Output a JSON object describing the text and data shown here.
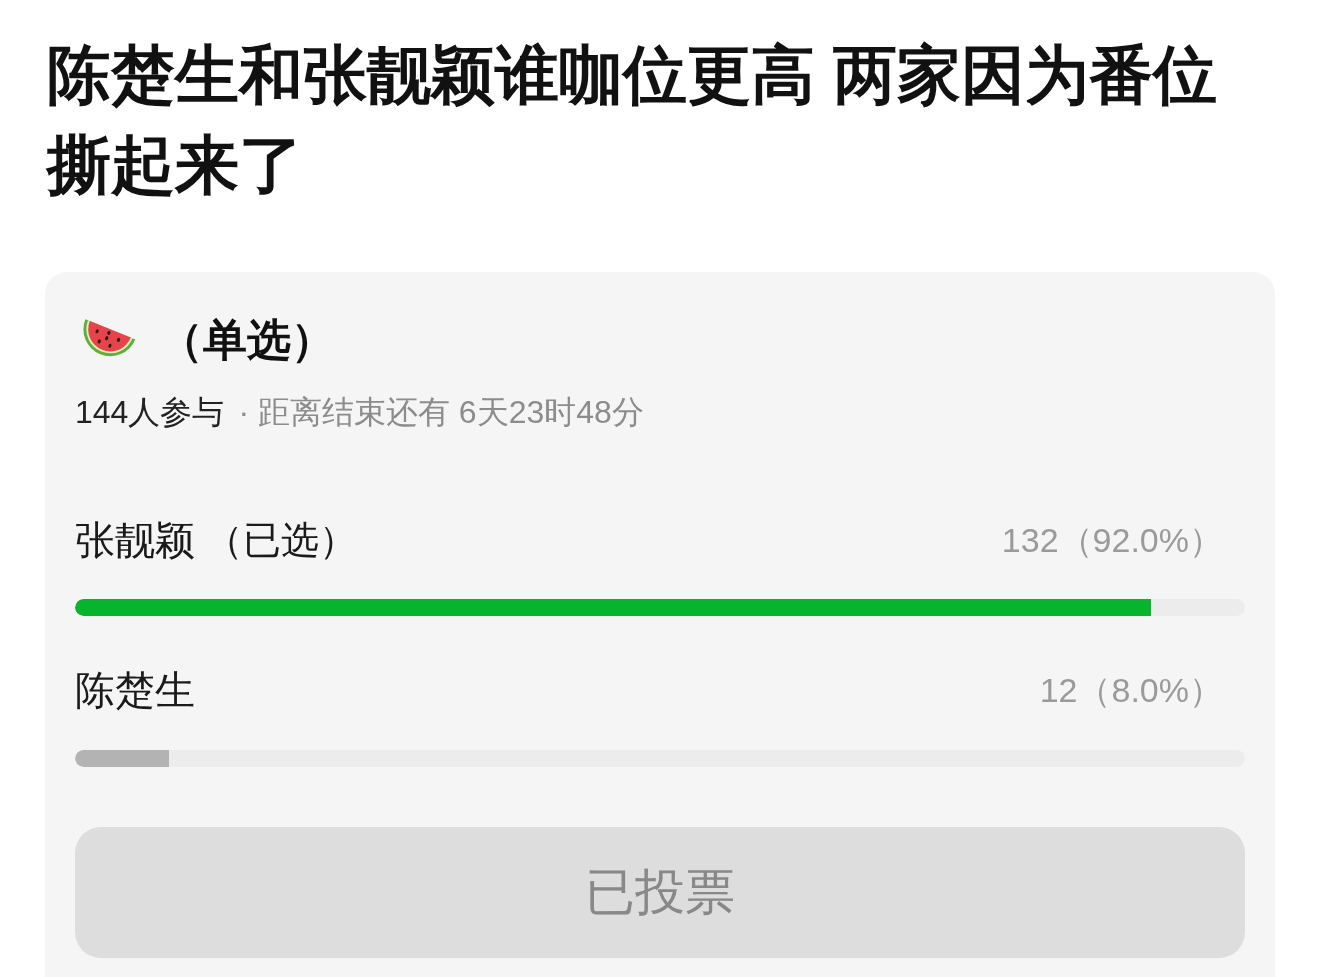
{
  "title": "陈楚生和张靓颖谁咖位更高 两家因为番位撕起来了",
  "poll": {
    "mode": "（单选）",
    "participants": "144人参与",
    "deadline": "· 距离结束还有 6天23时48分",
    "options": [
      {
        "name": "张靓颖",
        "tag": "（已选）",
        "selected": true,
        "result": "132（92.0%）",
        "level": 0.92
      },
      {
        "name": "陈楚生",
        "selected": false,
        "result": "12（8.0%）",
        "level": 0.08
      }
    ],
    "button": {
      "label": "已投票",
      "disabled": true
    }
  }
}
